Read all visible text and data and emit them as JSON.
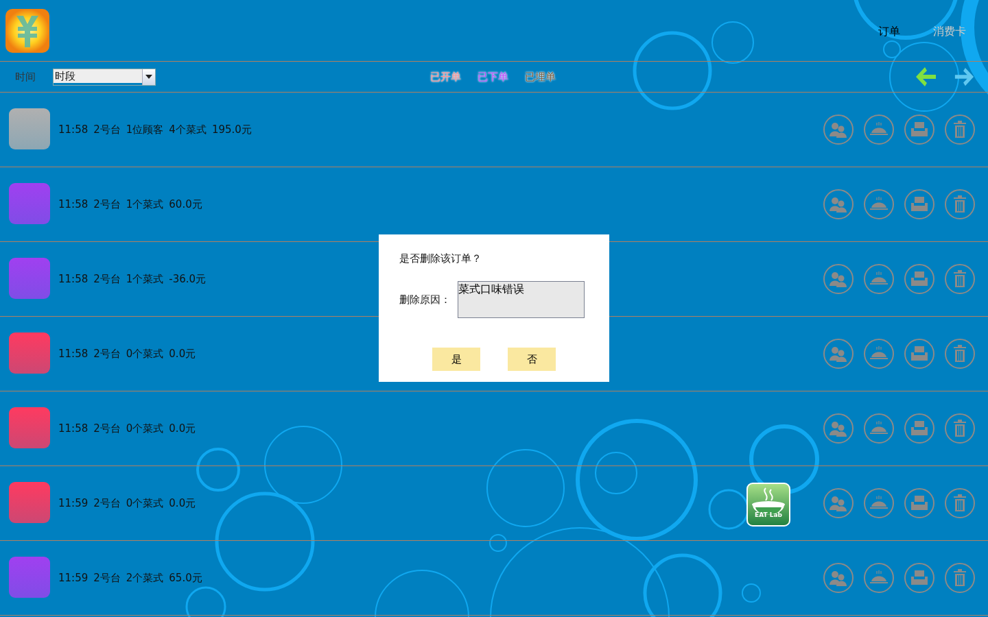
{
  "header": {
    "tabs": [
      {
        "label": "订单",
        "selected": true
      },
      {
        "label": "消费卡",
        "selected": false
      }
    ]
  },
  "filter_bar": {
    "label": "时间",
    "dropdown": {
      "value": "时段"
    },
    "statuses": [
      {
        "label": "已开单",
        "color": "#ff8c8c"
      },
      {
        "label": "已下单",
        "color": "#c040ff"
      },
      {
        "label": "已埋单",
        "color": "#7a5a3a"
      }
    ]
  },
  "orders": [
    {
      "color": "#b0b0b0",
      "time": "11:58",
      "table": "2号台",
      "guests": "1位顾客",
      "dishes": "4个菜式",
      "amount": "195.0元"
    },
    {
      "color": "#a040f0",
      "time": "11:58",
      "table": "2号台",
      "dishes": "1个菜式",
      "amount": "60.0元"
    },
    {
      "color": "#a040f0",
      "time": "11:58",
      "table": "2号台",
      "dishes": "1个菜式",
      "amount": "-36.0元"
    },
    {
      "color": "#ff3a60",
      "time": "11:58",
      "table": "2号台",
      "dishes": "0个菜式",
      "amount": "0.0元"
    },
    {
      "color": "#ff3a60",
      "time": "11:58",
      "table": "2号台",
      "dishes": "0个菜式",
      "amount": "0.0元"
    },
    {
      "color": "#ff3a60",
      "time": "11:59",
      "table": "2号台",
      "dishes": "0个菜式",
      "amount": "0.0元"
    },
    {
      "color": "#a040f0",
      "time": "11:59",
      "table": "2号台",
      "dishes": "2个菜式",
      "amount": "65.0元"
    }
  ],
  "floating_app": {
    "label": "EAT Lab"
  },
  "dialog": {
    "question": "是否删除该订单？",
    "reason_label": "删除原因：",
    "reason_value": "菜式口味错误",
    "buttons": [
      "是",
      "否"
    ]
  }
}
